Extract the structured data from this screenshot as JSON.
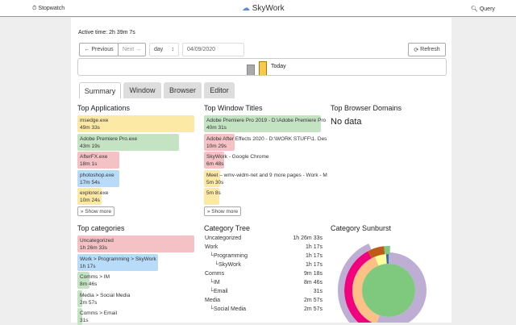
{
  "header": {
    "stopwatch": "Stopwatch",
    "brand": "SkyWork",
    "query": "Query"
  },
  "active_time": "Active time: 2h 39m 7s",
  "controls": {
    "previous": "Previous",
    "next": "Next",
    "period": "day",
    "date": "04/09/2020",
    "refresh": "Refresh"
  },
  "timeline": {
    "today_label": "Today"
  },
  "tabs": [
    "Summary",
    "Window",
    "Browser",
    "Editor"
  ],
  "top_apps": {
    "title": "Top Applications",
    "items": [
      {
        "name": "msedge.exe",
        "time": "49m 33s",
        "color": "#fde9a6",
        "frac": 1.0
      },
      {
        "name": "Adobe Premiere Pro.exe",
        "time": "43m 19s",
        "color": "#c3e3c3",
        "frac": 0.87
      },
      {
        "name": "AfterFX.exe",
        "time": "18m 1s",
        "color": "#f4c2c5",
        "frac": 0.36
      },
      {
        "name": "photoshop.exe",
        "time": "17m 54s",
        "color": "#b8dbf9",
        "frac": 0.36
      },
      {
        "name": "explorer.exe",
        "time": "10m 24s",
        "color": "#fde9a6",
        "frac": 0.21
      }
    ],
    "show_more": "Show more"
  },
  "top_titles": {
    "title": "Top Window Titles",
    "items": [
      {
        "name": "Adobe Premiere Pro 2019 - D:\\Adobe Premiere Pro",
        "time": "40m 31s",
        "color": "#c3e3c3",
        "frac": 1.0
      },
      {
        "name": "Adobe After Effects 2020 - D:\\WORK STUFF\\1. Des",
        "time": "10m 29s",
        "color": "#f4c2c5",
        "frac": 0.26
      },
      {
        "name": "SkyWork - Google Chrome",
        "time": "6m 48s",
        "color": "#f4c2c5",
        "frac": 0.17
      },
      {
        "name": "Meet – wmv-widm-net and 9 more pages - Work - M",
        "time": "5m 30s",
        "color": "#fde9a6",
        "frac": 0.14
      },
      {
        "name": "",
        "time": "5m 8s",
        "color": "#fde9a6",
        "frac": 0.13
      }
    ],
    "show_more": "Show more"
  },
  "top_domains": {
    "title": "Top Browser Domains",
    "empty": "No data"
  },
  "top_categories": {
    "title": "Top categories",
    "items": [
      {
        "name": "Uncategorized",
        "time": "1h 26m 33s",
        "color": "#f4c2c5",
        "frac": 1.0
      },
      {
        "name": "Work > Programming > SkyWork",
        "time": "1h 17s",
        "color": "#b8dbf9",
        "frac": 0.69
      },
      {
        "name": "Comms > IM",
        "time": "8m 46s",
        "color": "#c3e3c3",
        "frac": 0.1
      },
      {
        "name": "Media > Social Media",
        "time": "2m 57s",
        "color": "#c3e3c3",
        "frac": 0.034
      },
      {
        "name": "Comms > Email",
        "time": "31s",
        "color": "#c3e3c3",
        "frac": 0.006
      }
    ]
  },
  "category_tree": {
    "title": "Category Tree",
    "items": [
      {
        "name": "Uncategorized",
        "time": "1h 26m 33s",
        "depth": 0
      },
      {
        "name": "Work",
        "time": "1h 17s",
        "depth": 0
      },
      {
        "name": "└Programming",
        "time": "1h 17s",
        "depth": 1
      },
      {
        "name": "└SkyWork",
        "time": "1h 17s",
        "depth": 2
      },
      {
        "name": "Comms",
        "time": "9m 18s",
        "depth": 0
      },
      {
        "name": "└IM",
        "time": "8m 46s",
        "depth": 1
      },
      {
        "name": "└Email",
        "time": "31s",
        "depth": 1
      },
      {
        "name": "Media",
        "time": "2m 57s",
        "depth": 0
      },
      {
        "name": "└Social Media",
        "time": "2m 57s",
        "depth": 1
      }
    ]
  },
  "sunburst": {
    "title": "Category Sunburst"
  }
}
